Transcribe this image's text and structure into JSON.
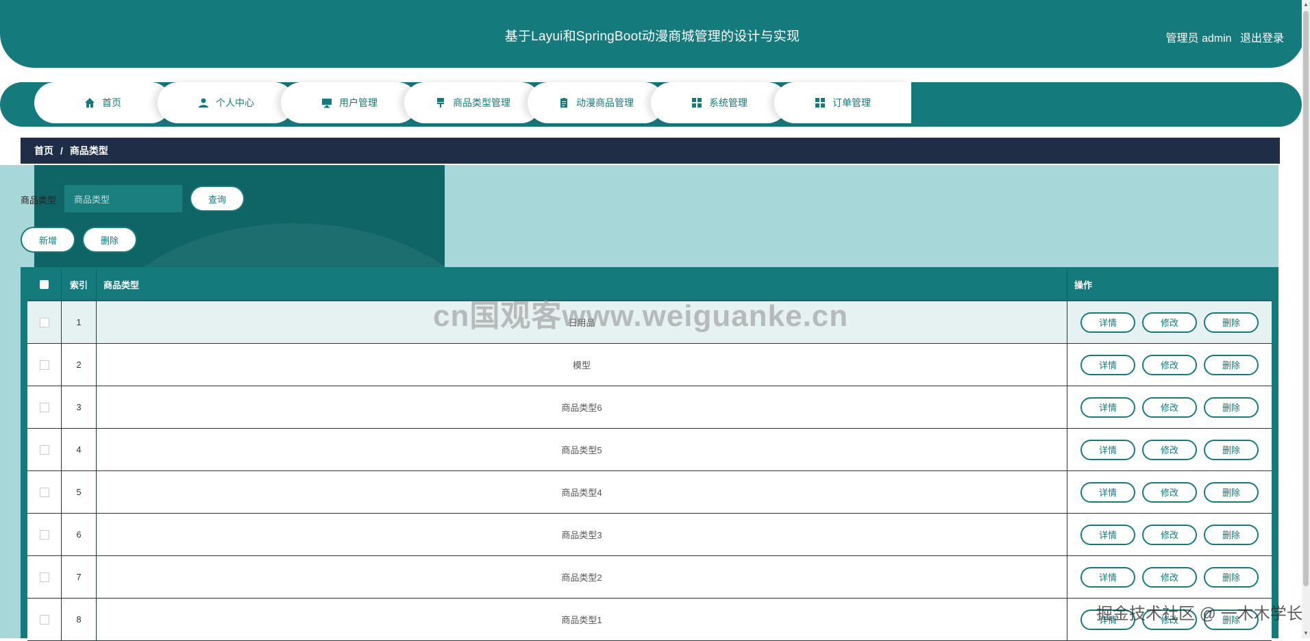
{
  "header": {
    "title": "基于Layui和SpringBoot动漫商城管理的设计与实现",
    "user_label": "管理员 admin",
    "logout_label": "退出登录"
  },
  "nav": [
    {
      "label": "首页",
      "icon": "home-icon"
    },
    {
      "label": "个人中心",
      "icon": "user-icon"
    },
    {
      "label": "用户管理",
      "icon": "monitor-icon"
    },
    {
      "label": "商品类型管理",
      "icon": "brush-icon"
    },
    {
      "label": "动漫商品管理",
      "icon": "clipboard-icon"
    },
    {
      "label": "系统管理",
      "icon": "grid-icon"
    },
    {
      "label": "订单管理",
      "icon": "grid-icon"
    }
  ],
  "breadcrumb": {
    "home": "首页",
    "sep": "/",
    "current": "商品类型"
  },
  "search": {
    "label": "商品类型",
    "placeholder": "商品类型",
    "query_button": "查询"
  },
  "actions": {
    "add_button": "新增",
    "delete_button": "删除"
  },
  "table": {
    "headers": {
      "index": "索引",
      "name": "商品类型",
      "ops": "操作"
    },
    "ops": {
      "detail": "详情",
      "edit": "修改",
      "delete": "删除"
    },
    "rows": [
      {
        "index": "1",
        "name": "日用品"
      },
      {
        "index": "2",
        "name": "模型"
      },
      {
        "index": "3",
        "name": "商品类型6"
      },
      {
        "index": "4",
        "name": "商品类型5"
      },
      {
        "index": "5",
        "name": "商品类型4"
      },
      {
        "index": "6",
        "name": "商品类型3"
      },
      {
        "index": "7",
        "name": "商品类型2"
      },
      {
        "index": "8",
        "name": "商品类型1"
      }
    ]
  },
  "watermarks": {
    "center": "cn国观客www.weiguanke.cn",
    "corner": "掘金技术社区 @ 一木木学长"
  },
  "colors": {
    "primary": "#157a7c",
    "dark": "#1f2d46",
    "content_bg": "#a7d7d8"
  }
}
